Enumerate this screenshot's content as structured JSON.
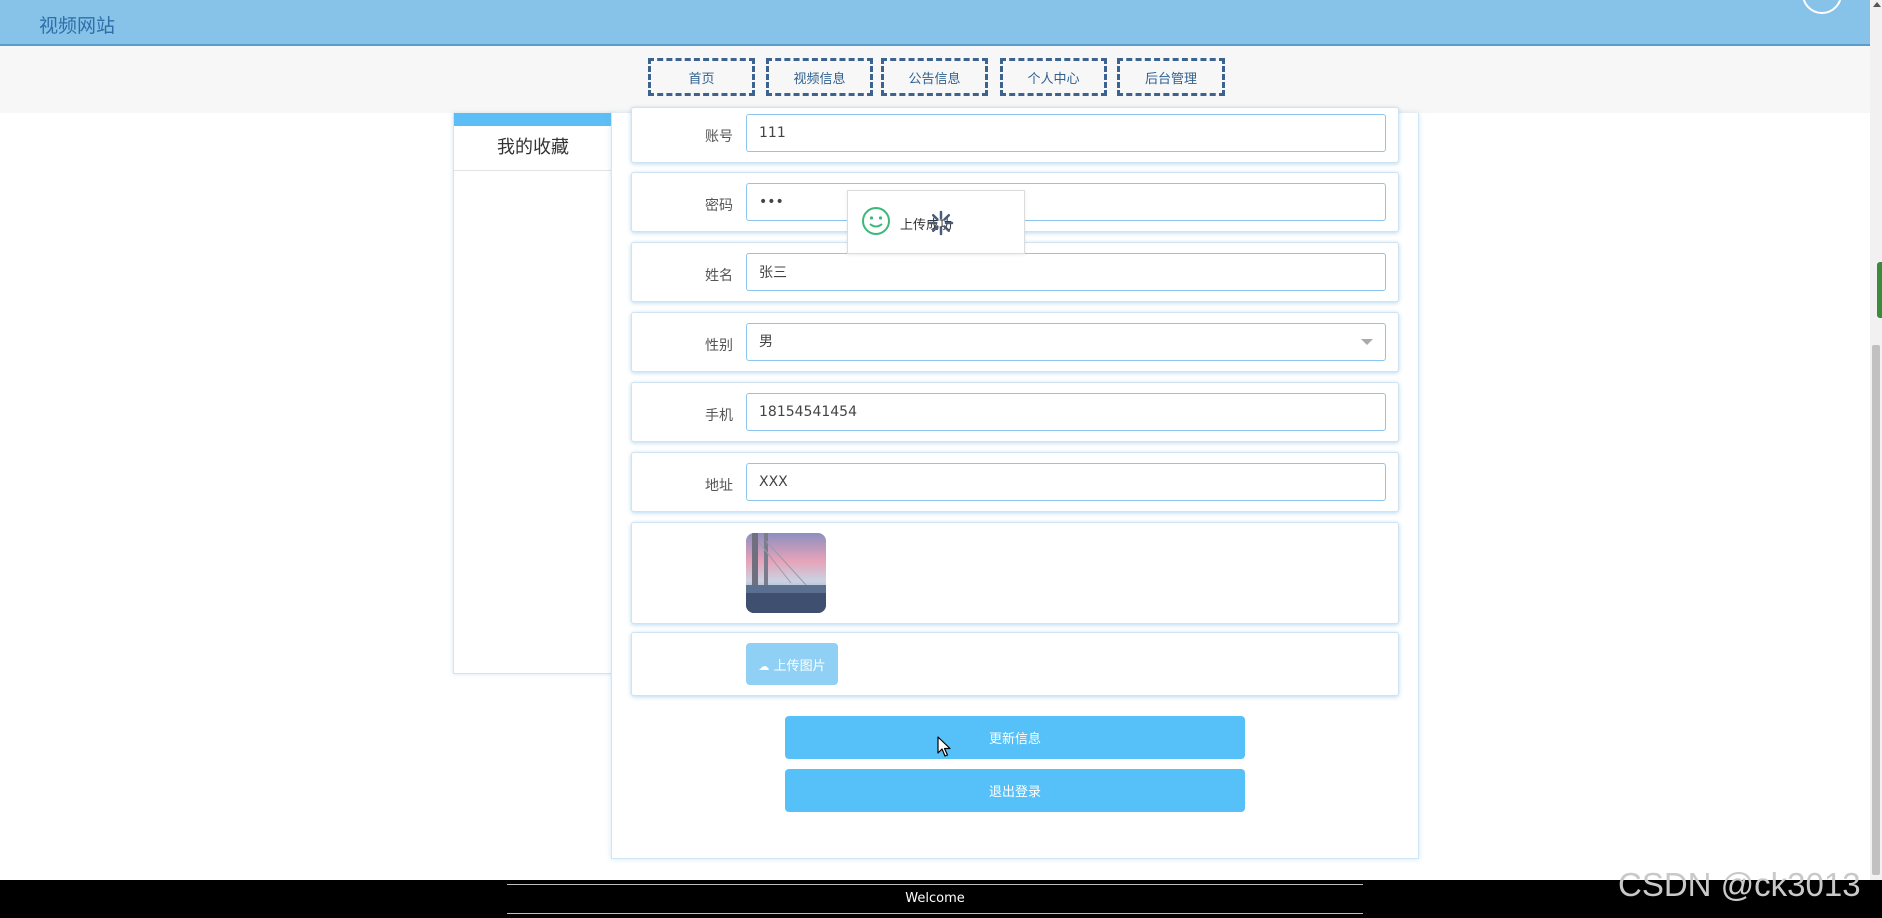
{
  "header": {
    "site_title": "视频网站"
  },
  "nav": {
    "items": [
      {
        "label": "首页"
      },
      {
        "label": "视频信息"
      },
      {
        "label": "公告信息"
      },
      {
        "label": "个人中心"
      },
      {
        "label": "后台管理"
      }
    ]
  },
  "sidebar": {
    "items": [
      {
        "label": "我的收藏"
      }
    ]
  },
  "form": {
    "account": {
      "label": "账号",
      "value": "111"
    },
    "password": {
      "label": "密码",
      "value": "•••"
    },
    "name": {
      "label": "姓名",
      "value": "张三"
    },
    "gender": {
      "label": "性别",
      "value": "男"
    },
    "phone": {
      "label": "手机",
      "value": "18154541454"
    },
    "address": {
      "label": "地址",
      "value": "XXX"
    },
    "upload_label": "上传图片",
    "update_label": "更新信息",
    "logout_label": "退出登录"
  },
  "toast": {
    "message": "上传成功"
  },
  "footer": {
    "text": "Welcome"
  },
  "watermark": "CSDN @ck3013",
  "colors": {
    "topbar": "#87c3e8",
    "nav_border": "#3c6390",
    "primary_button": "#56c0f8",
    "upload_button": "#8fd0f4",
    "field_border": "#8cc6ef",
    "success_icon": "#3cb878"
  },
  "icons": {
    "toast": "smile-icon",
    "upload": "cloud-upload-icon",
    "select": "chevron-down-icon",
    "loading": "spinner-icon"
  }
}
